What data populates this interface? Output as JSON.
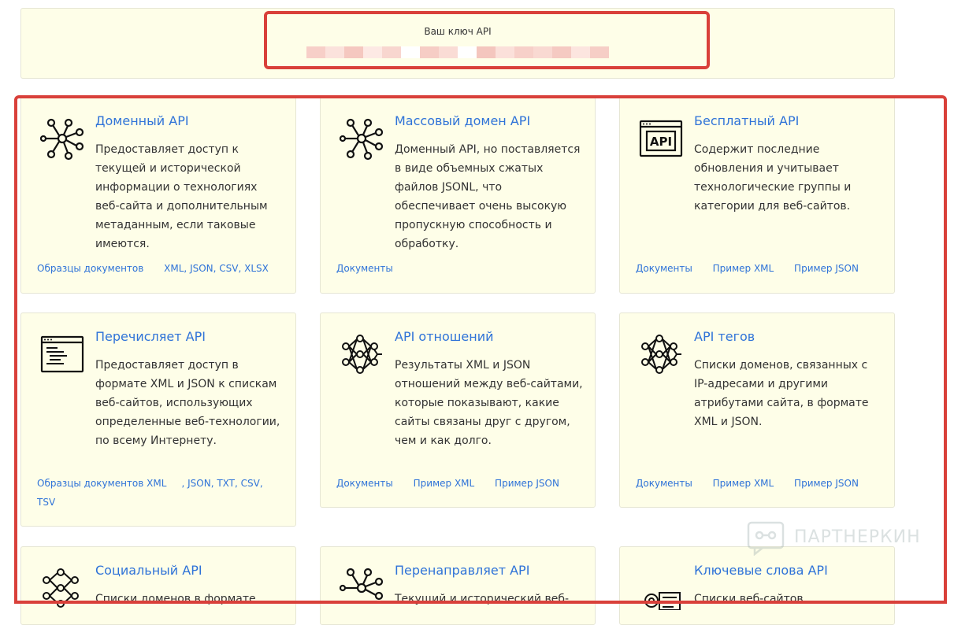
{
  "key_panel": {
    "label": "Ваш ключ API"
  },
  "cards": [
    {
      "title": "Доменный API",
      "desc": "Предоставляет доступ к текущей и исторической информации о технологиях веб-сайта и дополнительным метаданным, если таковые имеются.",
      "links": [
        "Образцы документов",
        "XML",
        "JSON",
        "CSV",
        "XLSX"
      ]
    },
    {
      "title": "Массовый домен API",
      "desc": "Доменный API, но поставляется в виде объемных сжатых файлов JSONL, что обеспечивает очень высокую пропускную способность и обработку.",
      "links": [
        "Документы"
      ]
    },
    {
      "title": "Бесплатный API",
      "desc": "Содержит последние обновления и учитывает технологические группы и категории для веб-сайтов.",
      "links": [
        "Документы",
        "Пример XML",
        "Пример JSON"
      ]
    },
    {
      "title": "Перечисляет API",
      "desc": "Предоставляет доступ в формате XML и JSON к спискам веб-сайтов, использующих определенные веб-технологии, по всему Интернету.",
      "links": [
        "Образцы документов",
        "XML",
        "JSON",
        "TXT",
        "CSV",
        "TSV"
      ]
    },
    {
      "title": "API отношений",
      "desc": "Результаты XML и JSON отношений между веб-сайтами, которые показывают, какие сайты связаны друг с другом, чем и как долго.",
      "links": [
        "Документы",
        "Пример XML",
        "Пример JSON"
      ]
    },
    {
      "title": "API тегов",
      "desc": "Списки доменов, связанных с IP-адресами и другими атрибутами сайта, в формате XML и JSON.",
      "links": [
        "Документы",
        "Пример XML",
        "Пример JSON"
      ]
    },
    {
      "title": "Социальный API",
      "desc": "Списки доменов в формате"
    },
    {
      "title": "Перенаправляет API",
      "desc": "Текущий и исторический веб-"
    },
    {
      "title": "Ключевые слова API",
      "desc": "Списки веб-сайтов"
    }
  ],
  "watermark": {
    "text": "ПАРТНЕРКИН"
  }
}
